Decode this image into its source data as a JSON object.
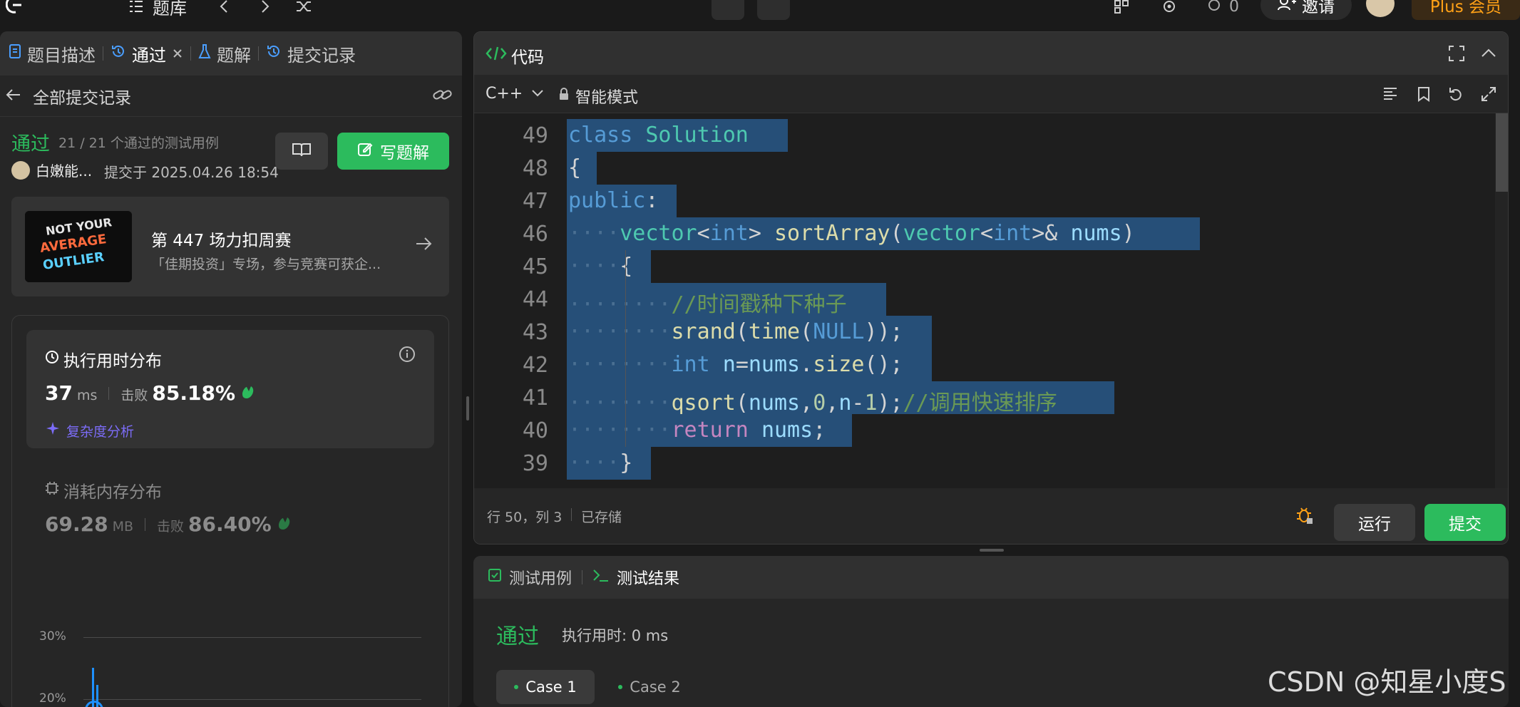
{
  "topnav": {
    "problems": "题库",
    "invite": "邀请",
    "count": "0",
    "plus": "Plus 会员"
  },
  "left": {
    "tabs": [
      {
        "label": "题目描述"
      },
      {
        "label": "通过"
      },
      {
        "label": "题解"
      },
      {
        "label": "提交记录"
      }
    ],
    "back_label": "全部提交记录",
    "status": "通过",
    "cases_info": "21 / 21 个通过的测试用例",
    "username": "白嫩能...",
    "submitted_at": "提交于 2025.04.26 18:54",
    "write_solution": "写题解",
    "contest": {
      "title": "第 447 场力扣周赛",
      "desc": "「佳期投资」专场，参与竞赛可获企...",
      "poster_text": "NOT YOUR AVERAGE OUTLIER"
    },
    "runtime": {
      "title": "执行用时分布",
      "value": "37",
      "unit": "ms",
      "beat_label": "击败",
      "beat_pct": "85.18%",
      "analysis": "复杂度分析"
    },
    "memory": {
      "title": "消耗内存分布",
      "value": "69.28",
      "unit": "MB",
      "beat_label": "击败",
      "beat_pct": "86.40%"
    },
    "chart_ticks": [
      "30%",
      "20%"
    ]
  },
  "code": {
    "title": "代码",
    "language": "C++",
    "mode": "智能模式",
    "lines": [
      {
        "num": "49",
        "text": "class Solution"
      },
      {
        "num": "48",
        "text": "{"
      },
      {
        "num": "47",
        "text": "public:"
      },
      {
        "num": "46",
        "text": "vector<int> sortArray(vector<int>& nums)"
      },
      {
        "num": "45",
        "text": "{"
      },
      {
        "num": "44",
        "text": "//时间戳种下种子"
      },
      {
        "num": "43",
        "text": "srand(time(NULL));"
      },
      {
        "num": "42",
        "text": "int n=nums.size();"
      },
      {
        "num": "41",
        "text": "qsort(nums,0,n-1);//调用快速排序"
      },
      {
        "num": "40",
        "text": "return nums;"
      },
      {
        "num": "39",
        "text": "}"
      }
    ],
    "cursor": "行 50，列 3",
    "saved": "已存储",
    "run": "运行",
    "submit": "提交"
  },
  "test": {
    "tab_cases": "测试用例",
    "tab_results": "测试结果",
    "status": "通过",
    "runtime": "执行用时: 0 ms",
    "cases": [
      "Case 1",
      "Case 2"
    ]
  },
  "watermark": "CSDN @知星小度S",
  "colors": {
    "accent_green": "#2cbb5d",
    "selection": "#264f78",
    "plus_orange": "#ffa116"
  }
}
